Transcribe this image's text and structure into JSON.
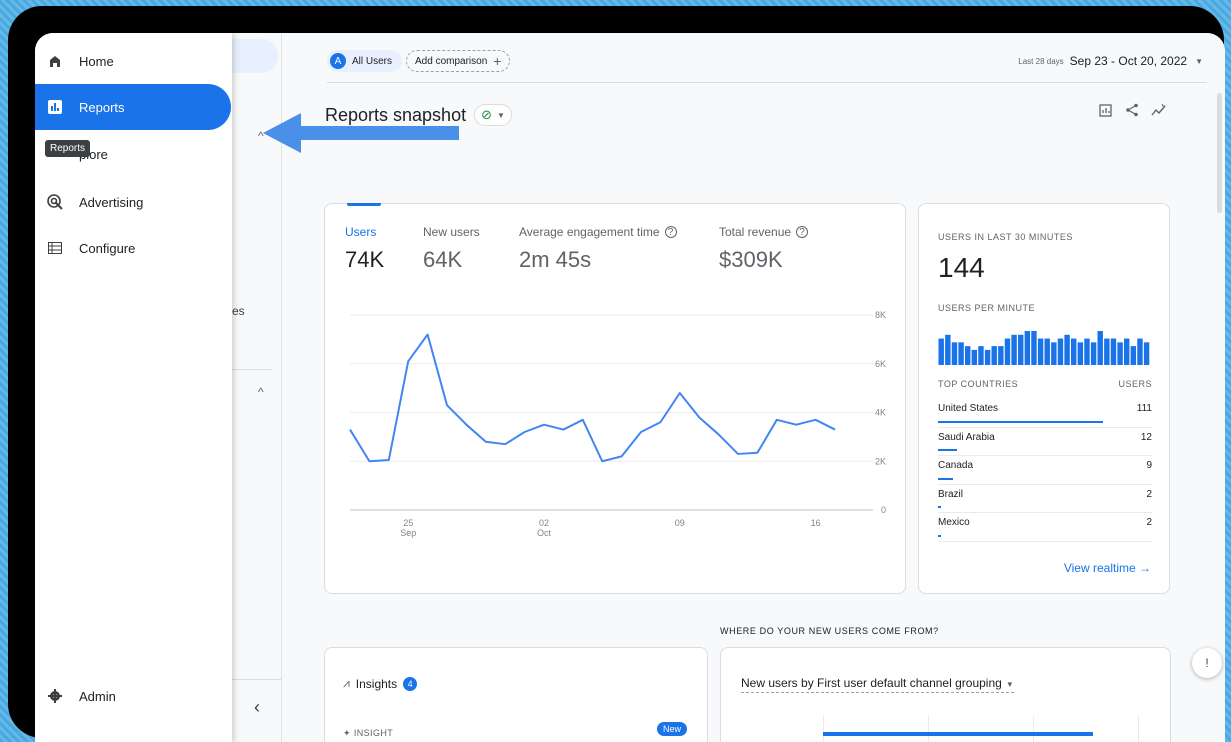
{
  "nav": {
    "items": [
      {
        "label": "Home",
        "icon": "home-icon"
      },
      {
        "label": "Reports",
        "icon": "bar-chart-icon"
      },
      {
        "label": "plore",
        "icon": "explore-icon"
      },
      {
        "label": "Advertising",
        "icon": "advertising-icon"
      },
      {
        "label": "Configure",
        "icon": "list-icon"
      }
    ],
    "tooltip": "Reports",
    "admin": "Admin"
  },
  "secondary": {
    "partial_label": "es"
  },
  "topbar": {
    "segment_badge": "A",
    "segment": "All Users",
    "add_comparison": "Add comparison",
    "range_hint": "Last 28 days",
    "date_range": "Sep 23 - Oct 20, 2022"
  },
  "page": {
    "title": "Reports snapshot"
  },
  "metrics": [
    {
      "label": "Users",
      "value": "74K"
    },
    {
      "label": "New users",
      "value": "64K"
    },
    {
      "label": "Average engagement time",
      "value": "2m 45s"
    },
    {
      "label": "Total revenue",
      "value": "$309K"
    }
  ],
  "chart_data": {
    "type": "line",
    "series": [
      {
        "values": [
          3300,
          2000,
          2050,
          6100,
          7200,
          4300,
          3500,
          2800,
          2700,
          3200,
          3500,
          3300,
          3700,
          2000,
          2200,
          3200,
          3600,
          4800,
          3800,
          3100,
          2300,
          2350,
          3700,
          3500,
          3700,
          3300
        ]
      }
    ],
    "x_ticks": [
      {
        "day": "25",
        "month": "Sep",
        "index": 3
      },
      {
        "day": "02",
        "month": "Oct",
        "index": 10
      },
      {
        "day": "09",
        "month": "",
        "index": 17
      },
      {
        "day": "16",
        "month": "",
        "index": 24
      }
    ],
    "y_ticks": [
      "8K",
      "6K",
      "4K",
      "2K",
      "0"
    ],
    "ylim": [
      0,
      8000
    ],
    "color": "#4285f4"
  },
  "realtime": {
    "title": "USERS IN LAST 30 MINUTES",
    "count": "144",
    "per_minute_label": "USERS PER MINUTE",
    "per_minute": [
      7,
      8,
      6,
      6,
      5,
      4,
      5,
      4,
      5,
      5,
      7,
      8,
      8,
      9,
      9,
      7,
      7,
      6,
      7,
      8,
      7,
      6,
      7,
      6,
      9,
      7,
      7,
      6,
      7,
      5,
      7,
      6
    ],
    "countries_header": "TOP COUNTRIES",
    "users_header": "USERS",
    "countries": [
      {
        "name": "United States",
        "users": "111",
        "share": 0.77
      },
      {
        "name": "Saudi Arabia",
        "users": "12",
        "share": 0.09
      },
      {
        "name": "Canada",
        "users": "9",
        "share": 0.07
      },
      {
        "name": "Brazil",
        "users": "2",
        "share": 0.012
      },
      {
        "name": "Mexico",
        "users": "2",
        "share": 0.012
      }
    ],
    "link": "View realtime"
  },
  "section_heading": "WHERE DO YOUR NEW USERS COME FROM?",
  "insights": {
    "title": "Insights",
    "count": "4",
    "sub": "INSIGHT",
    "badge": "New"
  },
  "new_users": {
    "title": "New users by First user default channel grouping"
  },
  "colors": {
    "accent": "#1a73e8",
    "frame": "#000000",
    "background": "#4aa8df"
  }
}
